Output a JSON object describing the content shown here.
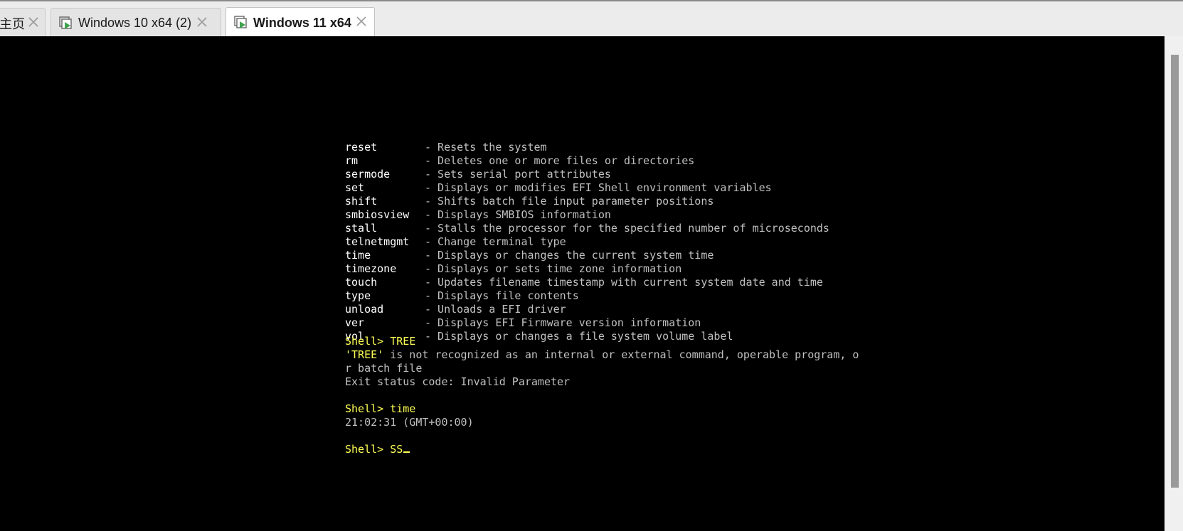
{
  "tabs": [
    {
      "label": "主页",
      "active": false
    },
    {
      "label": "Windows 10 x64 (2)",
      "active": false
    },
    {
      "label": "Windows 11 x64",
      "active": true
    }
  ],
  "help_commands": [
    {
      "name": "reset",
      "desc": "- Resets the system"
    },
    {
      "name": "rm",
      "desc": "- Deletes one or more files or directories"
    },
    {
      "name": "sermode",
      "desc": "- Sets serial port attributes"
    },
    {
      "name": "set",
      "desc": "- Displays or modifies EFI Shell environment variables"
    },
    {
      "name": "shift",
      "desc": "- Shifts batch file input parameter positions"
    },
    {
      "name": "smbiosview",
      "desc": "- Displays SMBIOS information"
    },
    {
      "name": "stall",
      "desc": "- Stalls the processor for the specified number of microseconds"
    },
    {
      "name": "telnetmgmt",
      "desc": "- Change terminal type"
    },
    {
      "name": "time",
      "desc": "- Displays or changes the current system time"
    },
    {
      "name": "timezone",
      "desc": "- Displays or sets time zone information"
    },
    {
      "name": "touch",
      "desc": "- Updates filename timestamp with current system date and time"
    },
    {
      "name": "type",
      "desc": "- Displays file contents"
    },
    {
      "name": "unload",
      "desc": "- Unloads a EFI driver"
    },
    {
      "name": "ver",
      "desc": "- Displays EFI Firmware version information"
    },
    {
      "name": "vol",
      "desc": "- Displays or changes a file system volume label"
    }
  ],
  "session": {
    "prompt1": "Shell> TREE",
    "error_quoted": "'TREE'",
    "error_line1_rest": " is not recognized as an internal or external command, operable program, o",
    "error_line2": "r batch file",
    "exit_status": "Exit status code: Invalid Parameter",
    "prompt2": "Shell> time",
    "time_output": "21:02:31 (GMT+00:00)",
    "prompt3": "Shell> SS"
  },
  "colors": {
    "prompt": "#ffff55",
    "output": "#c0c0c0",
    "command_name": "#ffffff",
    "background": "#000000"
  }
}
